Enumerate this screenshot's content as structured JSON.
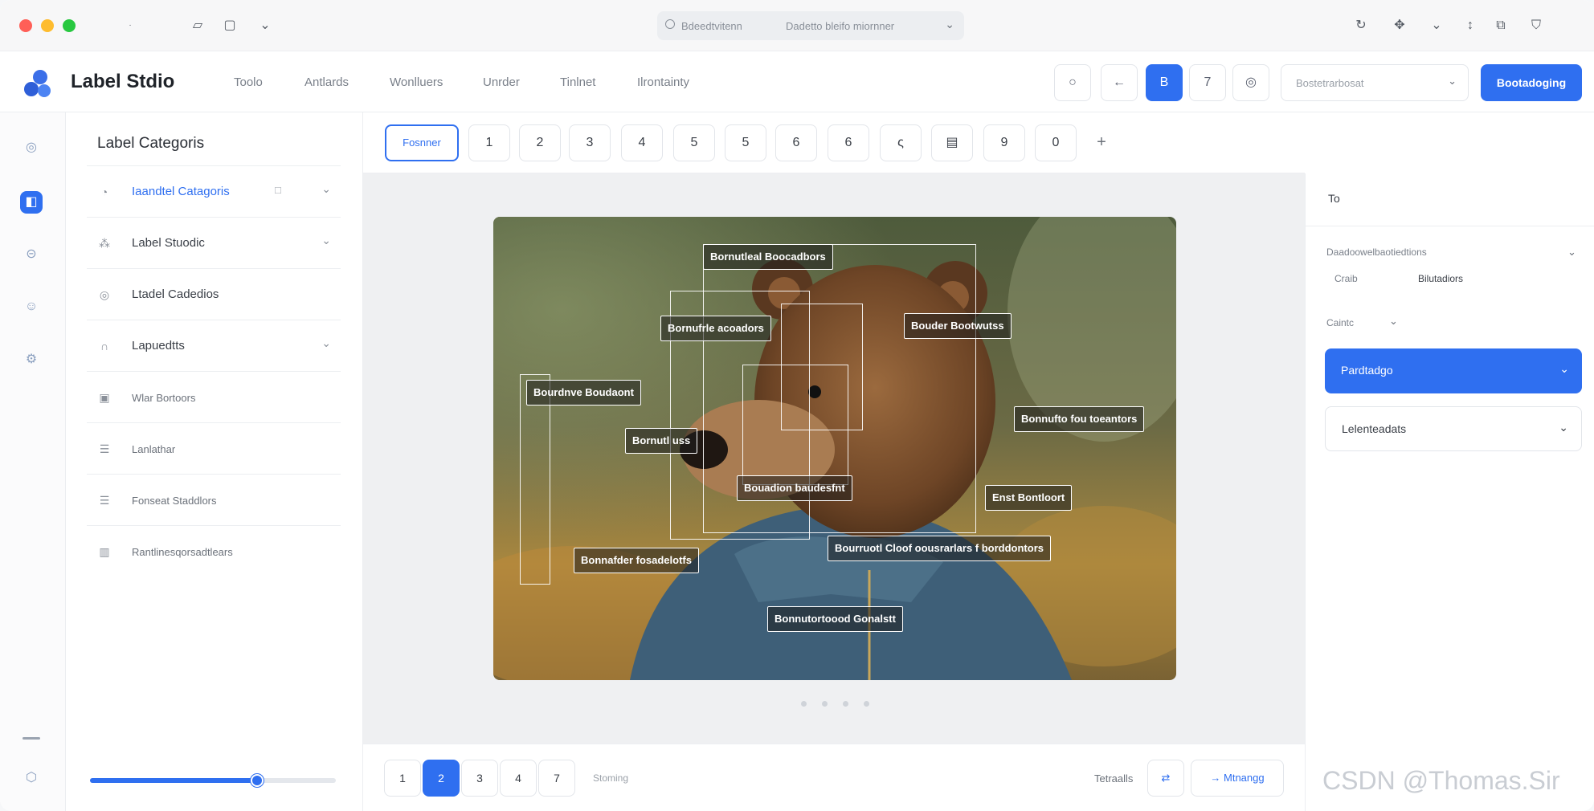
{
  "titlebar": {
    "traffic_colors": [
      "#ff5f57",
      "#febc2e",
      "#28c840"
    ],
    "url_part1": "Bdeedtvitenn",
    "url_part2": "Dadetto bleifo miornner",
    "icons": [
      "page-icon",
      "tab-icon",
      "chevron-down-icon",
      "refresh-icon",
      "puzzle-icon",
      "download-icon",
      "pin-icon",
      "share-icon",
      "shield-icon"
    ]
  },
  "app": {
    "brand": "Label Stdio",
    "accent": "#2f6ff0",
    "nav": [
      "Toolo",
      "Antlards",
      "Wonlluers",
      "Unrder",
      "Tinlnet",
      "Ilrontainty"
    ],
    "toolbar_buttons": [
      "○",
      "←",
      "B",
      "7",
      "◎"
    ],
    "select_placeholder": "Bostetrarbosat",
    "primary_button": "Bootadoging"
  },
  "categories": {
    "title": "Label Categoris",
    "items": [
      {
        "label": "Iaandtel Catagoris",
        "icon": "◔",
        "chevron": true,
        "badge": "□",
        "active": true
      },
      {
        "label": "Label Stuodic",
        "icon": "⁂",
        "chevron": true
      },
      {
        "label": "Ltadel Cadedios",
        "icon": "◎",
        "chevron": false
      },
      {
        "label": "Lapuedtts",
        "icon": "∩",
        "chevron": true
      },
      {
        "label": "Wlar Bortoors",
        "icon": "▣",
        "chevron": false,
        "small": true
      },
      {
        "label": "Lanlathar",
        "icon": "☰",
        "chevron": false,
        "small": true
      },
      {
        "label": "Fonseat Staddlors",
        "icon": "☰",
        "chevron": false,
        "small": true
      },
      {
        "label": "Rantlinesqorsadtlears",
        "icon": "▥",
        "chevron": false,
        "small": true
      }
    ],
    "zoom_fraction": 0.68
  },
  "strip": {
    "first": "Fosnner",
    "pages": [
      "1",
      "2",
      "3",
      "4",
      "5",
      "5",
      "6",
      "6",
      "ς",
      "▤",
      "9",
      "0"
    ],
    "plus": "+"
  },
  "annotations": [
    "Bornutleal Boocadbors",
    "Bornufrle acoadors",
    "Bouder Bootwutss",
    "Bourdnve Boudaont",
    "Bornutl uss",
    "Bonnufto fou toeantors",
    "Bouadion baudesfnt",
    "Enst Bontloort",
    "Bourruotl Cloof oousrarlars f borddontors",
    "Bonnafder fosadelotfs",
    "Bonnutortoood Gonalstt"
  ],
  "footer": {
    "pages": [
      "1",
      "2",
      "3",
      "4",
      "7"
    ],
    "active_page": "2",
    "status": "Stoming",
    "right_label": "Tetraalls",
    "icon_button": "⇄",
    "next_button": "→  Mtnangg"
  },
  "right_panel": {
    "header": "To",
    "section": "Daadoowelbaotiedtions",
    "row_a": "Craib",
    "row_b": "Bilutadiors",
    "row_c": "Caintc",
    "dropdown_blue": "Pardtadgo",
    "dropdown_plain": "Lelenteadats"
  },
  "watermark": "CSDN @Thomas.Sir"
}
